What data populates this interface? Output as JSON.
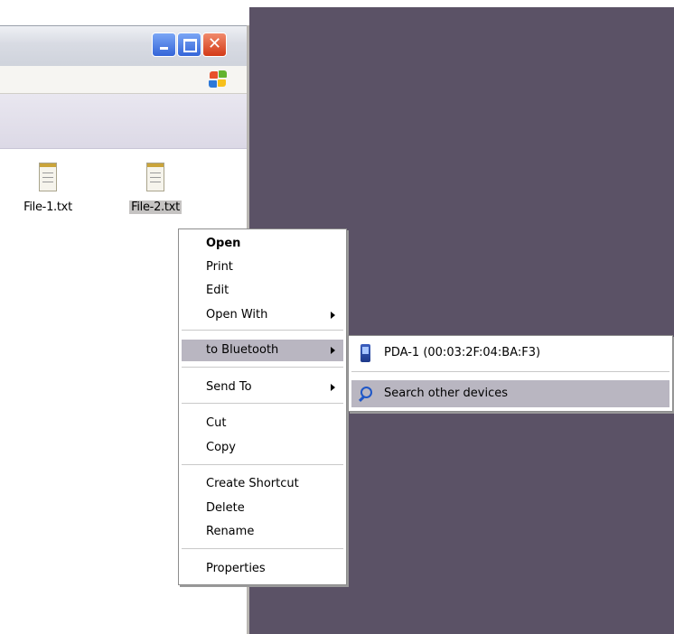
{
  "window": {
    "close_glyph": "✕",
    "files": [
      {
        "name": "File-1.txt",
        "selected": false
      },
      {
        "name": "File-2.txt",
        "selected": true
      }
    ]
  },
  "context_menu": {
    "items": [
      {
        "label": "Open",
        "bold": true,
        "submenu": false,
        "highlighted": false
      },
      {
        "label": "Print",
        "bold": false,
        "submenu": false,
        "highlighted": false
      },
      {
        "label": "Edit",
        "bold": false,
        "submenu": false,
        "highlighted": false
      },
      {
        "label": "Open With",
        "bold": false,
        "submenu": true,
        "highlighted": false
      },
      {
        "label": "to Bluetooth",
        "bold": false,
        "submenu": true,
        "highlighted": true
      },
      {
        "label": "Send To",
        "bold": false,
        "submenu": true,
        "highlighted": false
      },
      {
        "label": "Cut",
        "bold": false,
        "submenu": false,
        "highlighted": false
      },
      {
        "label": "Copy",
        "bold": false,
        "submenu": false,
        "highlighted": false
      },
      {
        "label": "Create Shortcut",
        "bold": false,
        "submenu": false,
        "highlighted": false
      },
      {
        "label": "Delete",
        "bold": false,
        "submenu": false,
        "highlighted": false
      },
      {
        "label": "Rename",
        "bold": false,
        "submenu": false,
        "highlighted": false
      },
      {
        "label": "Properties",
        "bold": false,
        "submenu": false,
        "highlighted": false
      }
    ]
  },
  "bluetooth_submenu": {
    "items": [
      {
        "label": "PDA-1 (00:03:2F:04:BA:F3)",
        "icon": "pda-icon",
        "highlighted": false
      },
      {
        "label": "Search other devices",
        "icon": "search-icon",
        "highlighted": true
      }
    ]
  },
  "colors": {
    "desktop": "#5b5266",
    "menu_highlight": "#b9b6c1",
    "selection": "#c5c3c2"
  }
}
